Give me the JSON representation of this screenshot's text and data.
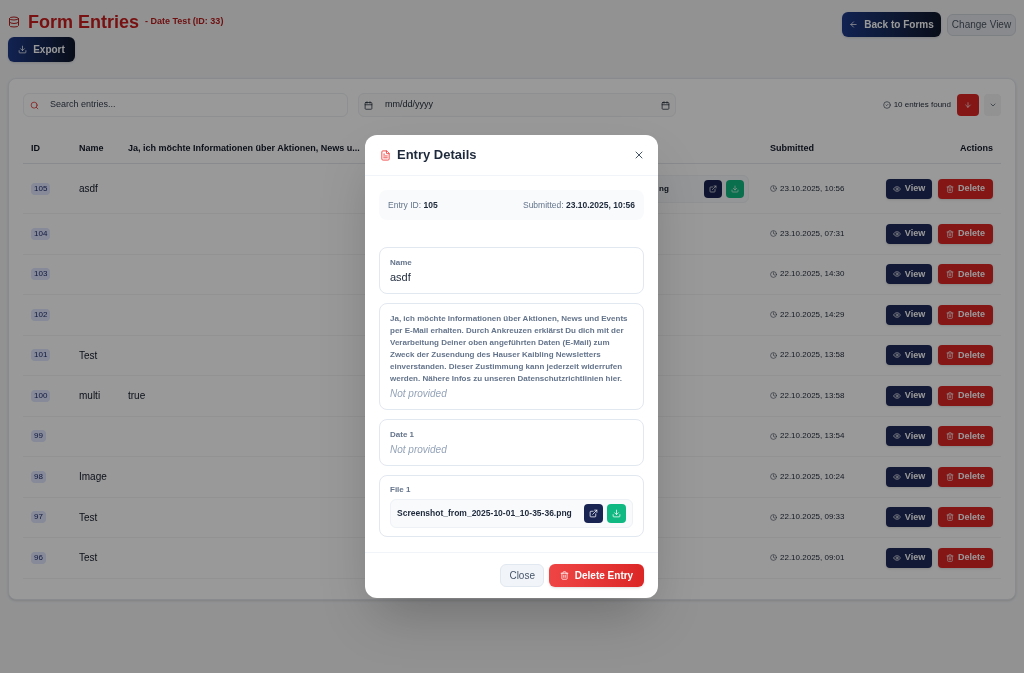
{
  "header": {
    "title": "Form Entries",
    "subtitle": "- Date Test (ID: 33)",
    "export_button": "Export",
    "buttons": [
      {
        "kind": "back",
        "label": "Back to Forms",
        "disabled": false
      },
      {
        "kind": "view",
        "label": "Change View",
        "disabled": true
      }
    ]
  },
  "filters": {
    "search": {
      "placeholder": "Search entries..."
    },
    "date": {
      "placeholder": "mm/dd/yyyy"
    },
    "count": "10 entries found"
  },
  "table": {
    "columns": [
      "ID",
      "Name",
      "Ja, ich möchte Informationen über Aktionen, News u...",
      "Submitted",
      "Actions"
    ],
    "rows": [
      {
        "id": "105",
        "name": "asdf",
        "file": "ng",
        "submitted": "23.10.2025, 10:56",
        "view": "View",
        "delete": "Delete"
      },
      {
        "id": "104",
        "submitted": "23.10.2025, 07:31",
        "view": "View",
        "delete": "Delete"
      },
      {
        "id": "103",
        "submitted": "22.10.2025, 14:30",
        "view": "View",
        "delete": "Delete"
      },
      {
        "id": "102",
        "submitted": "22.10.2025, 14:29",
        "view": "View",
        "delete": "Delete"
      },
      {
        "id": "101",
        "name": "Test",
        "submitted": "22.10.2025, 13:58",
        "view": "View",
        "delete": "Delete"
      },
      {
        "id": "100",
        "name": "multi",
        "column_3": "true",
        "submitted": "22.10.2025, 13:58",
        "view": "View",
        "delete": "Delete"
      },
      {
        "id": "99",
        "submitted": "22.10.2025, 13:54",
        "view": "View",
        "delete": "Delete"
      },
      {
        "id": "98",
        "name": "Image",
        "submitted": "22.10.2025, 10:24",
        "view": "View",
        "delete": "Delete"
      },
      {
        "id": "97",
        "name": "Test",
        "submitted": "22.10.2025, 09:33",
        "view": "View",
        "delete": "Delete"
      },
      {
        "id": "96",
        "name": "Test",
        "submitted": "22.10.2025, 09:01",
        "view": "View",
        "delete": "Delete"
      }
    ]
  },
  "modal": {
    "title": "Entry Details",
    "entry_id_label": "Entry ID:",
    "entry_id": "105",
    "submitted_label": "Submitted:",
    "submitted": "23.10.2025, 10:56",
    "fields": [
      {
        "kind": "text",
        "label": "Name",
        "value": "asdf",
        "provided": true
      },
      {
        "kind": "text",
        "label": "Ja, ich möchte Informationen über Aktionen, News und Events per E-Mail erhalten. Durch Ankreuzen erklärst Du dich mit der Verarbeitung Deiner oben angeführten Daten (E-Mail) zum Zweck der Zusendung des Hauser Kaibling Newsletters einverstanden. Dieser Zustimmung kann jederzeit widerrufen werden. Nähere Infos zu unseren Datenschutzrichtlinien hier.",
        "value": "Not provided",
        "provided": false
      },
      {
        "kind": "text",
        "label": "Date 1",
        "value": "Not provided",
        "provided": false
      },
      {
        "kind": "file",
        "label": "File 1",
        "file": "Screenshot_from_2025-10-01_10-35-36.png"
      }
    ],
    "buttons": [
      {
        "kind": "close",
        "label": "Close"
      },
      {
        "kind": "delete",
        "label": "Delete Entry"
      }
    ]
  }
}
